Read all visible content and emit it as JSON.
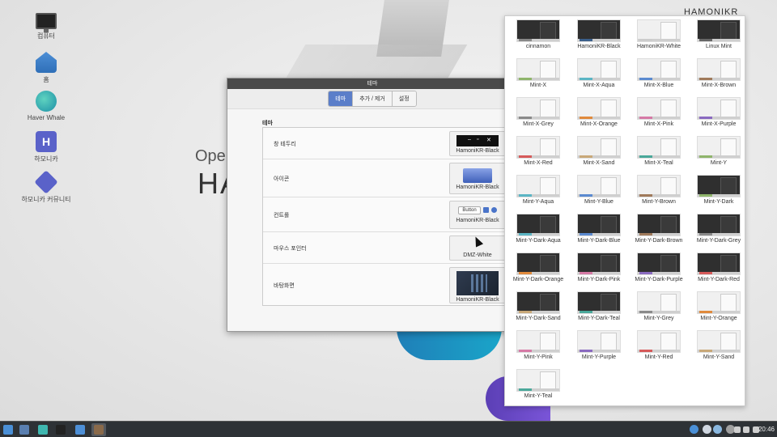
{
  "desktop": {
    "icons": [
      {
        "label": "컴퓨터",
        "icon": "monitor-icon"
      },
      {
        "label": "홈",
        "icon": "home-folder-icon"
      },
      {
        "label": "Haver Whale",
        "icon": "whale-browser-icon"
      },
      {
        "label": "하모니카",
        "icon": "hamonikr-icon"
      },
      {
        "label": "하모니카 커뮤니티",
        "icon": "community-icon"
      }
    ],
    "bg_text_open": "Ope",
    "bg_text_ha": "HA",
    "bg_logo": "HAMONIKR"
  },
  "theme_window": {
    "title": "테마",
    "tabs": [
      {
        "label": "테마",
        "active": true
      },
      {
        "label": "추가 / 제거",
        "active": false
      },
      {
        "label": "설정",
        "active": false
      }
    ],
    "section_title": "테마",
    "rows": [
      {
        "label": "창 테두리",
        "value": "HamoniKR-Black"
      },
      {
        "label": "아이콘",
        "value": "HamoniKR-Black"
      },
      {
        "label": "컨트롤",
        "value": "HamoniKR-Black",
        "preview_button": "Button"
      },
      {
        "label": "마우스 포인터",
        "value": "DMZ-White"
      },
      {
        "label": "바탕화면",
        "value": "HamoniKR-Black"
      }
    ]
  },
  "picker": {
    "themes": [
      {
        "name": "cinnamon",
        "dark": true,
        "accent": "#888888"
      },
      {
        "name": "HamoniKR-Black",
        "dark": true,
        "accent": "#3b5f8a"
      },
      {
        "name": "HamoniKR-White",
        "dark": false,
        "accent": "#cccccc"
      },
      {
        "name": "Linux Mint",
        "dark": true,
        "accent": "#666666"
      },
      {
        "name": "Mint-X",
        "dark": false,
        "accent": "#8fb56b"
      },
      {
        "name": "Mint-X-Aqua",
        "dark": false,
        "accent": "#5bb5c4"
      },
      {
        "name": "Mint-X-Blue",
        "dark": false,
        "accent": "#5b8ad0"
      },
      {
        "name": "Mint-X-Brown",
        "dark": false,
        "accent": "#a07a5b"
      },
      {
        "name": "Mint-X-Grey",
        "dark": false,
        "accent": "#8a8a8a"
      },
      {
        "name": "Mint-X-Orange",
        "dark": false,
        "accent": "#e08a3c"
      },
      {
        "name": "Mint-X-Pink",
        "dark": false,
        "accent": "#d67aa6"
      },
      {
        "name": "Mint-X-Purple",
        "dark": false,
        "accent": "#8a6ac0"
      },
      {
        "name": "Mint-X-Red",
        "dark": false,
        "accent": "#d65a5a"
      },
      {
        "name": "Mint-X-Sand",
        "dark": false,
        "accent": "#c8a878"
      },
      {
        "name": "Mint-X-Teal",
        "dark": false,
        "accent": "#4aa89a"
      },
      {
        "name": "Mint-Y",
        "dark": false,
        "accent": "#8fb56b"
      },
      {
        "name": "Mint-Y-Aqua",
        "dark": false,
        "accent": "#5bb5c4"
      },
      {
        "name": "Mint-Y-Blue",
        "dark": false,
        "accent": "#5b8ad0"
      },
      {
        "name": "Mint-Y-Brown",
        "dark": false,
        "accent": "#a07a5b"
      },
      {
        "name": "Mint-Y-Dark",
        "dark": true,
        "accent": "#8fb56b"
      },
      {
        "name": "Mint-Y-Dark-Aqua",
        "dark": true,
        "accent": "#5bb5c4"
      },
      {
        "name": "Mint-Y-Dark-Blue",
        "dark": true,
        "accent": "#5b8ad0"
      },
      {
        "name": "Mint-Y-Dark-Brown",
        "dark": true,
        "accent": "#a07a5b"
      },
      {
        "name": "Mint-Y-Dark-Grey",
        "dark": true,
        "accent": "#8a8a8a"
      },
      {
        "name": "Mint-Y-Dark-Orange",
        "dark": true,
        "accent": "#e08a3c"
      },
      {
        "name": "Mint-Y-Dark-Pink",
        "dark": true,
        "accent": "#d67aa6"
      },
      {
        "name": "Mint-Y-Dark-Purple",
        "dark": true,
        "accent": "#8a6ac0"
      },
      {
        "name": "Mint-Y-Dark-Red",
        "dark": true,
        "accent": "#d65a5a"
      },
      {
        "name": "Mint-Y-Dark-Sand",
        "dark": true,
        "accent": "#c8a878"
      },
      {
        "name": "Mint-Y-Dark-Teal",
        "dark": true,
        "accent": "#4aa89a"
      },
      {
        "name": "Mint-Y-Grey",
        "dark": false,
        "accent": "#8a8a8a"
      },
      {
        "name": "Mint-Y-Orange",
        "dark": false,
        "accent": "#e08a3c"
      },
      {
        "name": "Mint-Y-Pink",
        "dark": false,
        "accent": "#d67aa6"
      },
      {
        "name": "Mint-Y-Purple",
        "dark": false,
        "accent": "#8a6ac0"
      },
      {
        "name": "Mint-Y-Red",
        "dark": false,
        "accent": "#d65a5a"
      },
      {
        "name": "Mint-Y-Sand",
        "dark": false,
        "accent": "#c8a878"
      },
      {
        "name": "Mint-Y-Teal",
        "dark": false,
        "accent": "#4aa89a"
      }
    ]
  },
  "taskbar": {
    "apps": [
      {
        "name": "start-menu-icon",
        "color": "#4a8fd6"
      },
      {
        "name": "show-desktop-icon",
        "color": "#5a7fb0"
      },
      {
        "name": "whale-browser-icon",
        "color": "#3fb7b0"
      },
      {
        "name": "terminal-icon",
        "color": "#222222"
      },
      {
        "name": "files-icon",
        "color": "#4d8fd6"
      },
      {
        "name": "theme-app-icon",
        "color": "#8a6a4a"
      }
    ],
    "tray": [
      {
        "name": "bluetooth-icon",
        "color": "#4a8fd6"
      },
      {
        "name": "shield-icon",
        "color": "#cfd6e0"
      },
      {
        "name": "update-icon",
        "color": "#8ab8e0"
      },
      {
        "name": "user-icon",
        "color": "#a0a0a0"
      },
      {
        "name": "network-icon",
        "color": "#cfcfcf"
      },
      {
        "name": "volume-icon",
        "color": "#cfcfcf"
      },
      {
        "name": "battery-icon",
        "color": "#cfcfcf"
      }
    ],
    "clock": "20:46"
  }
}
